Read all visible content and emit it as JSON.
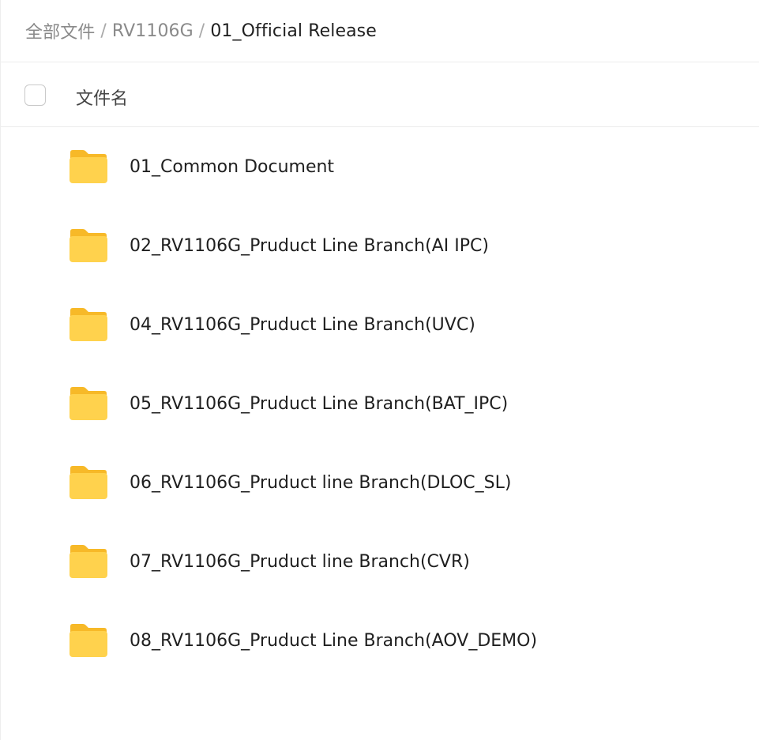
{
  "breadcrumb": {
    "items": [
      "全部文件",
      "RV1106G",
      "01_Official Release"
    ],
    "separator": "/"
  },
  "table": {
    "column_name": "文件名"
  },
  "files": [
    {
      "name": "01_Common Document",
      "icon": "folder-icon"
    },
    {
      "name": "02_RV1106G_Pruduct Line Branch(AI IPC)",
      "icon": "folder-icon"
    },
    {
      "name": "04_RV1106G_Pruduct Line Branch(UVC)",
      "icon": "folder-icon"
    },
    {
      "name": "05_RV1106G_Pruduct Line Branch(BAT_IPC)",
      "icon": "folder-icon"
    },
    {
      "name": "06_RV1106G_Pruduct line Branch(DLOC_SL)",
      "icon": "folder-icon"
    },
    {
      "name": "07_RV1106G_Pruduct line Branch(CVR)",
      "icon": "folder-icon"
    },
    {
      "name": "08_RV1106G_Pruduct Line Branch(AOV_DEMO)",
      "icon": "folder-icon"
    }
  ],
  "colors": {
    "folder_body": "#FFD24D",
    "folder_tab": "#F7B928",
    "text_primary": "#1f1f1f",
    "text_secondary": "#8a8a8a"
  }
}
